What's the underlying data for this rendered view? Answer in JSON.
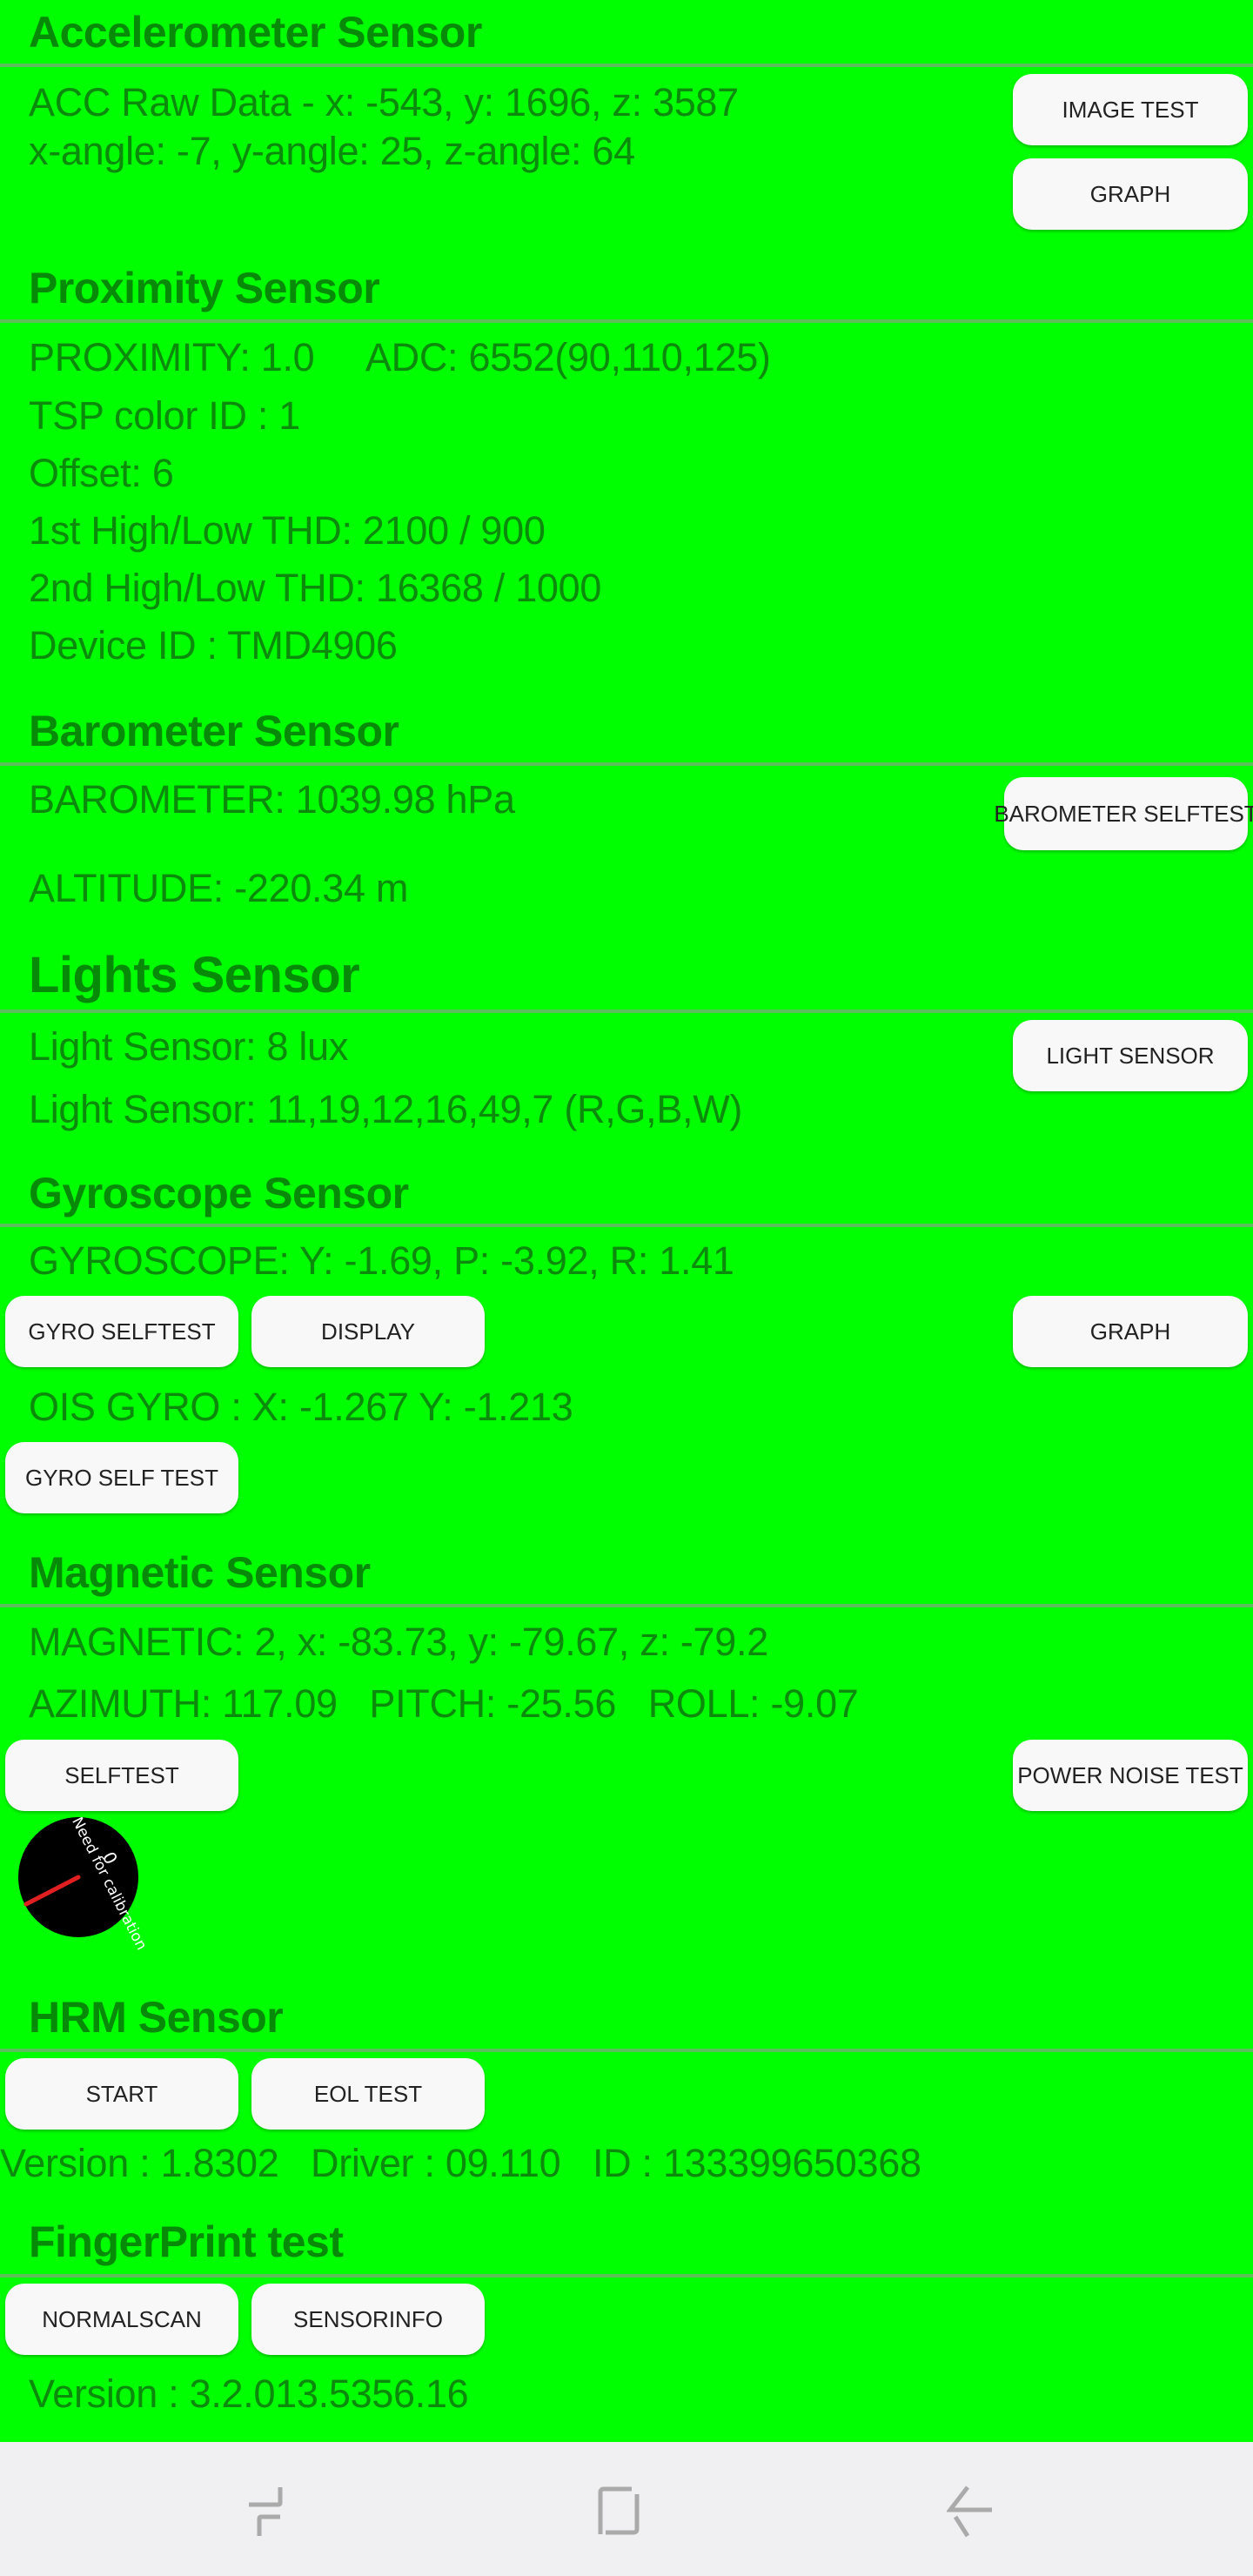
{
  "accelerometer": {
    "title": "Accelerometer Sensor",
    "raw": "ACC Raw Data - x: -543, y: 1696, z: 3587",
    "angles": "x-angle: -7, y-angle: 25, z-angle: 64",
    "buttons": {
      "image_test": "IMAGE TEST",
      "graph": "GRAPH"
    }
  },
  "proximity": {
    "title": "Proximity Sensor",
    "proximity_adc": "PROXIMITY: 1.0     ADC: 6552(90,110,125)",
    "tsp_color": "TSP color ID : 1",
    "offset": "Offset: 6",
    "thd1": "1st High/Low THD: 2100 / 900",
    "thd2": "2nd High/Low THD: 16368 / 1000",
    "device_id": "Device ID : TMD4906"
  },
  "barometer": {
    "title": "Barometer Sensor",
    "pressure": "BAROMETER: 1039.98 hPa",
    "altitude": "ALTITUDE: -220.34 m",
    "buttons": {
      "selftest": "BAROMETER SELFTEST"
    }
  },
  "lights": {
    "title": "Lights Sensor",
    "lux": "Light Sensor: 8 lux",
    "rgbw": "Light Sensor: 11,19,12,16,49,7 (R,G,B,W)",
    "buttons": {
      "light_sensor": "LIGHT SENSOR"
    }
  },
  "gyroscope": {
    "title": "Gyroscope Sensor",
    "values": "GYROSCOPE: Y: -1.69, P: -3.92, R: 1.41",
    "ois": "OIS GYRO : X: -1.267 Y: -1.213",
    "buttons": {
      "gyro_selftest": "GYRO SELFTEST",
      "display": "DISPLAY",
      "graph": "GRAPH",
      "gyro_self_test": "GYRO SELF TEST"
    }
  },
  "magnetic": {
    "title": "Magnetic Sensor",
    "values": "MAGNETIC: 2, x: -83.73, y: -79.67, z: -79.2",
    "orientation": "AZIMUTH: 117.09   PITCH: -25.56   ROLL: -9.07",
    "buttons": {
      "selftest": "SELFTEST",
      "power_noise": "POWER NOISE TEST"
    },
    "compass": {
      "label": "Need for calibration",
      "value": "0",
      "needle_color": "#e02020"
    }
  },
  "hrm": {
    "title": "HRM Sensor",
    "info": "Version : 1.8302   Driver : 09.110   ID : 133399650368",
    "buttons": {
      "start": "START",
      "eol_test": "EOL TEST"
    }
  },
  "fingerprint": {
    "title": "FingerPrint test",
    "version": "Version : 3.2.013.5356.16",
    "buttons": {
      "normalscan": "NORMALSCAN",
      "sensorinfo": "SENSORINFO"
    }
  },
  "navbar": {
    "recent": "recent-apps-icon",
    "home": "home-icon",
    "back": "back-icon"
  },
  "colors": {
    "background": "#00ff00",
    "text": "#0b8a0b",
    "button": "#f8f8f8"
  }
}
